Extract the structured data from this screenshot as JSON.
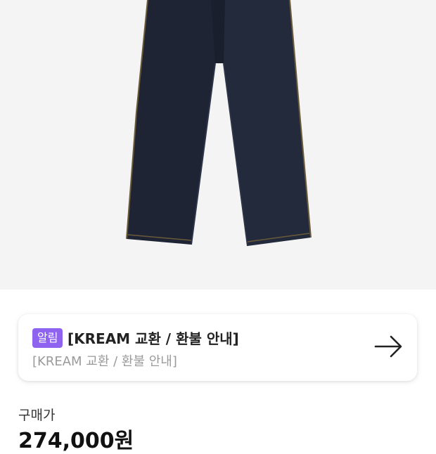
{
  "notice": {
    "badge": "알림",
    "title": "[KREAM 교환 / 환불 안내]",
    "subtitle": "[KREAM 교환 / 환불 안내]",
    "arrow_icon": "arrow-right-icon",
    "badge_color": "#8d63ef"
  },
  "price": {
    "label": "구매가",
    "value": "274,000원"
  },
  "product": {
    "image_icon": "denim-jeans-image"
  },
  "colors": {
    "background": "#f4f4f4",
    "denim": "#1e2434"
  }
}
